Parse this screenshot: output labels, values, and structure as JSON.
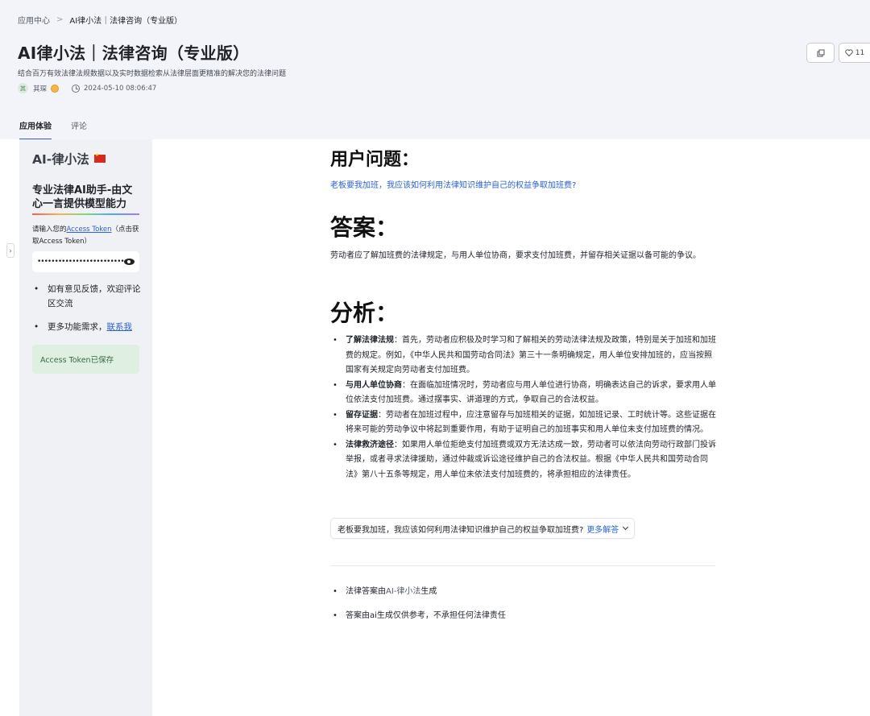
{
  "breadcrumb": {
    "home": "应用中心",
    "separator": ">",
    "current": "AI律小法｜法律咨询（专业版）"
  },
  "header": {
    "title": "AI律小法｜法律咨询（专业版）",
    "subtitle": "结合百万有效法律法规数据以及实时数据检索从法律层面更精准的解决您的法律问题",
    "author_initial": "其",
    "author": "其琛",
    "timestamp": "2024-05-10 08:06:47",
    "like_count": "11",
    "copy_icon": "copy-icon",
    "like_icon": "heart-icon"
  },
  "tabs": [
    {
      "label": "应用体验",
      "active": true
    },
    {
      "label": "评论",
      "active": false
    }
  ],
  "sidebar": {
    "collapse_glyph": "›",
    "logo": "AI-律小法",
    "heading": "专业法律AI助手-由文心一言提供模型能力",
    "token_prompt_prefix": "请输入您的",
    "token_link": "Access Token",
    "token_prompt_suffix": "（点击获取Access Token）",
    "token_value": "••••••••••••••••••••••••••••••••",
    "items": [
      {
        "text": "如有意见反馈，欢迎评论区交流"
      },
      {
        "prefix": "更多功能需求，",
        "link": "联系我"
      }
    ],
    "saved_message": "Access Token已保存"
  },
  "main": {
    "question_heading": "用户问题：",
    "question": "老板要我加班，我应该如何利用法律知识维护自己的权益争取加班费?",
    "answer_heading": "答案：",
    "answer": "劳动者应了解加班费的法律规定，与用人单位协商，要求支付加班费，并留存相关证据以备可能的争议。",
    "analysis_heading": "分析：",
    "analysis": [
      {
        "title": "了解法律法规",
        "text": "：首先，劳动者应积极及时学习和了解相关的劳动法律法规及政策，特别是关于加班和加班费的规定。例如，《中华人民共和国劳动合同法》第三十一条明确规定，用人单位安排加班的，应当按照国家有关规定向劳动者支付加班费。"
      },
      {
        "title": "与用人单位协商",
        "text": "：在面临加班情况时，劳动者应与用人单位进行协商，明确表达自己的诉求，要求用人单位依法支付加班费。通过摆事实、讲道理的方式，争取自己的合法权益。"
      },
      {
        "title": "留存证据",
        "text": "：劳动者在加班过程中，应注意留存与加班相关的证据，如加班记录、工时统计等。这些证据在将来可能的劳动争议中将起到重要作用，有助于证明自己的加班事实和用人单位未支付加班费的情况。"
      },
      {
        "title": "法律救济途径",
        "text": "：如果用人单位拒绝支付加班费或双方无法达成一致，劳动者可以依法向劳动行政部门投诉举报，或者寻求法律援助，通过仲裁或诉讼途径维护自己的合法权益。根据《中华人民共和国劳动合同法》第八十五条等规定，用人单位未依法支付加班费的，将承担相应的法律责任。"
      }
    ],
    "more_question": "老板要我加班，我应该如何利用法律知识维护自己的权益争取加班费?",
    "more_label": "更多解答",
    "footer": [
      {
        "prefix": "法律答案由",
        "ai": "AI-律小法",
        "suffix": "生成"
      },
      {
        "text": "答案由ai生成仅供参考，不承担任何法律责任"
      }
    ]
  }
}
